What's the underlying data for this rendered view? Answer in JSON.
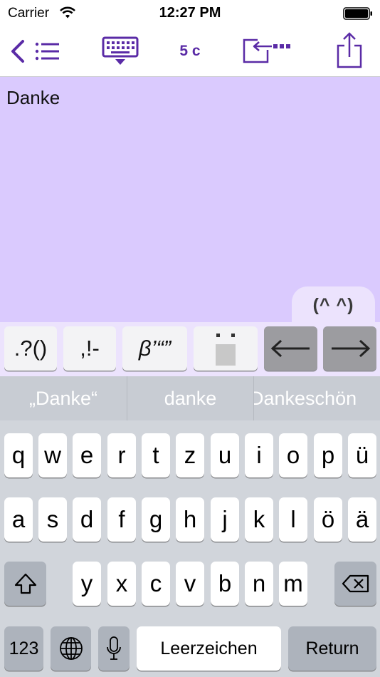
{
  "status_bar": {
    "carrier": "Carrier",
    "time": "12:27 PM"
  },
  "toolbar": {
    "char_count": "5 c"
  },
  "editor": {
    "text": "Danke"
  },
  "emoticon_tab": {
    "label": "(^ ^)"
  },
  "extra_keys": {
    "punct1": ".?()",
    "punct2": ",!-",
    "quotes": "β’“”",
    "diaeresis": "¨"
  },
  "suggestions": [
    "„Danke“",
    "danke",
    "Dankeschön"
  ],
  "keyboard": {
    "row1": [
      "q",
      "w",
      "e",
      "r",
      "t",
      "z",
      "u",
      "i",
      "o",
      "p",
      "ü"
    ],
    "row2": [
      "a",
      "s",
      "d",
      "f",
      "g",
      "h",
      "j",
      "k",
      "l",
      "ö",
      "ä"
    ],
    "row3": [
      "y",
      "x",
      "c",
      "v",
      "b",
      "n",
      "m"
    ],
    "numbers_label": "123",
    "space_label": "Leerzeichen",
    "return_label": "Return"
  },
  "colors": {
    "accent": "#5a2ba6",
    "editor_bg": "#dacafe",
    "extra_row_bg": "#ece3fd",
    "keyboard_bg": "#d1d5db"
  }
}
